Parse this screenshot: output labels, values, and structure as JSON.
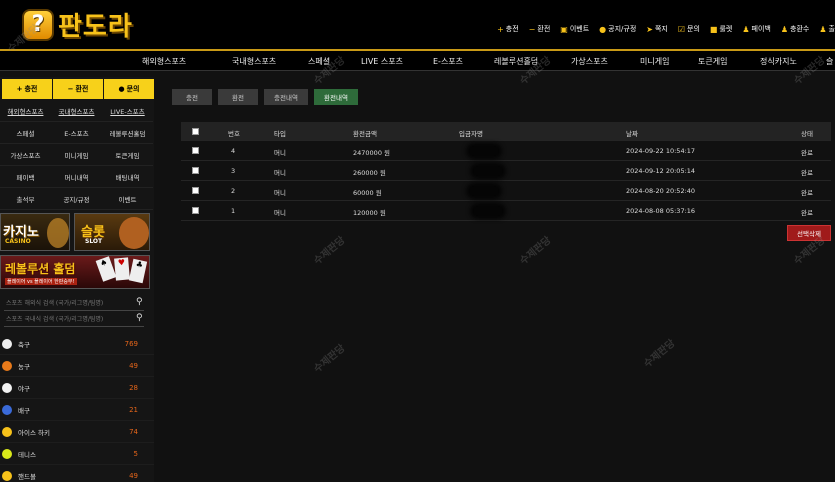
{
  "brand": {
    "logo_text": "판도라",
    "logo_mark": "?"
  },
  "top_links": [
    {
      "icon": "plus-icon",
      "glyph": "+",
      "label": "충전"
    },
    {
      "icon": "minus-icon",
      "glyph": "−",
      "label": "환전"
    },
    {
      "icon": "gift-icon",
      "glyph": "▣",
      "label": "이벤트"
    },
    {
      "icon": "info-icon",
      "glyph": "●",
      "label": "공지/규정"
    },
    {
      "icon": "send-icon",
      "glyph": "➤",
      "label": "쪽지"
    },
    {
      "icon": "check-icon",
      "glyph": "☑",
      "label": "문의"
    },
    {
      "icon": "dice-icon",
      "glyph": "■",
      "label": "룰렛"
    },
    {
      "icon": "user-icon",
      "glyph": "♟",
      "label": "페이백"
    },
    {
      "icon": "user-add-icon",
      "glyph": "♟",
      "label": "충환수"
    },
    {
      "icon": "user2-icon",
      "glyph": "♟",
      "label": "출"
    }
  ],
  "main_nav": [
    "해외형스포츠",
    "국내형스포츠",
    "스페셜",
    "LIVE 스포츠",
    "E-스포츠",
    "레볼루션홀덤",
    "가상스포츠",
    "미니게임",
    "토큰게임",
    "정식카지노",
    "슬"
  ],
  "sidebar": {
    "buttons": [
      {
        "glyph": "+",
        "label": "충전"
      },
      {
        "glyph": "−",
        "label": "환전"
      },
      {
        "glyph": "●",
        "label": "문의"
      }
    ],
    "menu": [
      "해외형스포츠",
      "국내형스포츠",
      "LIVE-스포츠",
      "스페셜",
      "E-스포츠",
      "레볼루션홀덤",
      "가상스포츠",
      "미니게임",
      "토큰게임",
      "페이백",
      "머니내역",
      "배팅내역",
      "출석부",
      "공지/규정",
      "이벤트"
    ],
    "banners": {
      "casino": "카지노",
      "casino_sub": "CASINO",
      "slot": "슬롯",
      "slot_sub": "SLOT",
      "holdem": "레볼루션 홀덤",
      "holdem_sub": "플레이어 vs 플레이어 한판승부!"
    },
    "search": [
      {
        "placeholder": "스포츠 해외식 검색 (국가/리그명/팀명)"
      },
      {
        "placeholder": "스포츠 국내식 검색 (국가/리그명/팀명)"
      }
    ],
    "sports": [
      {
        "name": "축구",
        "count": "769",
        "color": "#eeeeee"
      },
      {
        "name": "농구",
        "count": "49",
        "color": "#e87a1a"
      },
      {
        "name": "야구",
        "count": "28",
        "color": "#f2f2f2"
      },
      {
        "name": "배구",
        "count": "21",
        "color": "#3a6ad8"
      },
      {
        "name": "아이스 하키",
        "count": "74",
        "color": "#f7c21a"
      },
      {
        "name": "테니스",
        "count": "5",
        "color": "#d9e81a"
      },
      {
        "name": "핸드볼",
        "count": "49",
        "color": "#f7c21a"
      }
    ]
  },
  "tabs": [
    "충전",
    "환전",
    "충전내역",
    "환전내역"
  ],
  "table": {
    "headers": [
      "번호",
      "타입",
      "환전금액",
      "입금자명",
      "날짜",
      "상태"
    ],
    "rows": [
      {
        "no": "4",
        "type": "머니",
        "amount": "2470000 원",
        "date": "2024-09-22 10:54:17",
        "status": "완료"
      },
      {
        "no": "3",
        "type": "머니",
        "amount": "260000 원",
        "date": "2024-09-12 20:05:14",
        "status": "완료"
      },
      {
        "no": "2",
        "type": "머니",
        "amount": "60000 원",
        "date": "2024-08-20 20:52:40",
        "status": "완료"
      },
      {
        "no": "1",
        "type": "머니",
        "amount": "120000 원",
        "date": "2024-08-08 05:37:16",
        "status": "완료"
      }
    ]
  },
  "delete_label": "선택삭제",
  "watermark": "수제판당"
}
